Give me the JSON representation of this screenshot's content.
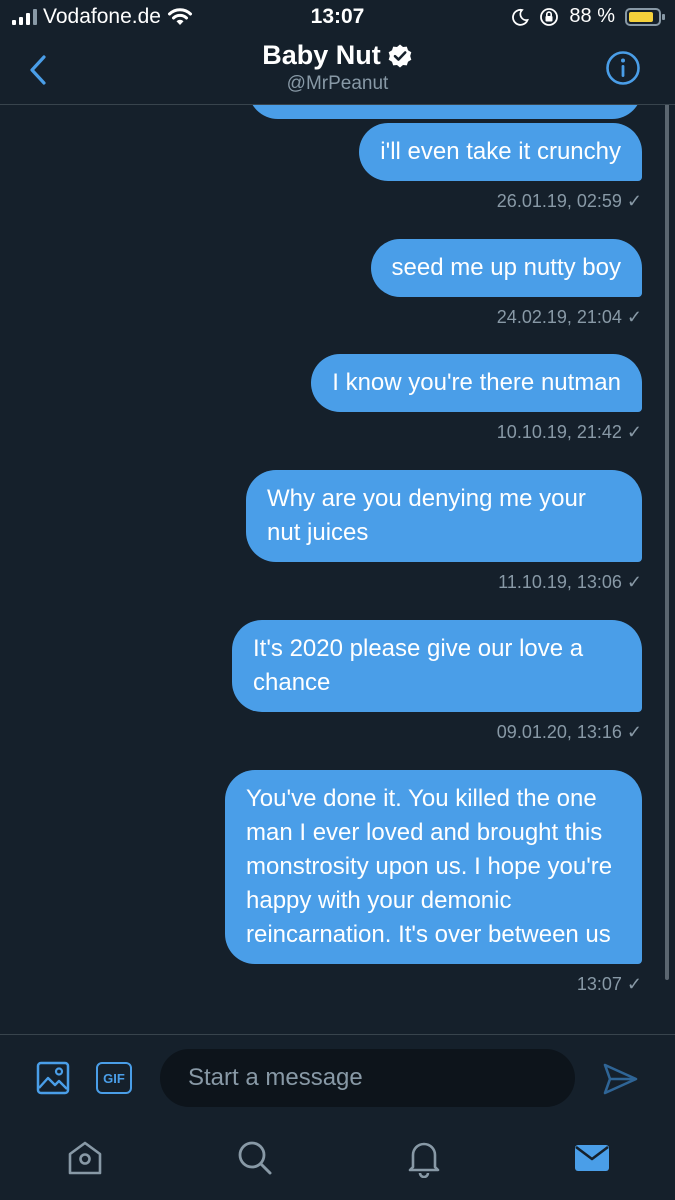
{
  "status_bar": {
    "carrier": "Vodafone.de",
    "time": "13:07",
    "battery_percent": "88 %",
    "battery_level": 0.88
  },
  "header": {
    "name": "Baby Nut",
    "handle": "@MrPeanut",
    "verified": true
  },
  "messages": [
    {
      "text": "i'll even take it crunchy",
      "timestamp": "26.01.19, 02:59 ✓"
    },
    {
      "text": "seed me up nutty boy",
      "timestamp": "24.02.19, 21:04 ✓"
    },
    {
      "text": "I know you're there nutman",
      "timestamp": "10.10.19, 21:42 ✓"
    },
    {
      "text": "Why are you denying me your nut juices",
      "timestamp": "11.10.19, 13:06 ✓"
    },
    {
      "text": "It's 2020 please give our love a chance",
      "timestamp": "09.01.20, 13:16 ✓"
    },
    {
      "text": "You've done it. You killed the one man I ever loved and brought this monstrosity upon us. I hope you're happy with your demonic reincarnation. It's over between us",
      "timestamp": "13:07 ✓"
    }
  ],
  "composer": {
    "placeholder": "Start a message",
    "gif_label": "GIF"
  },
  "icons": {
    "back": "chevron-left-icon",
    "info": "info-icon",
    "media": "image-icon",
    "send": "send-icon",
    "tabs": [
      "home-icon",
      "search-icon",
      "notifications-icon",
      "messages-icon"
    ]
  },
  "colors": {
    "background": "#15202b",
    "accent": "#4a9ee8",
    "muted": "#8899a6",
    "battery": "#f5d13b"
  }
}
